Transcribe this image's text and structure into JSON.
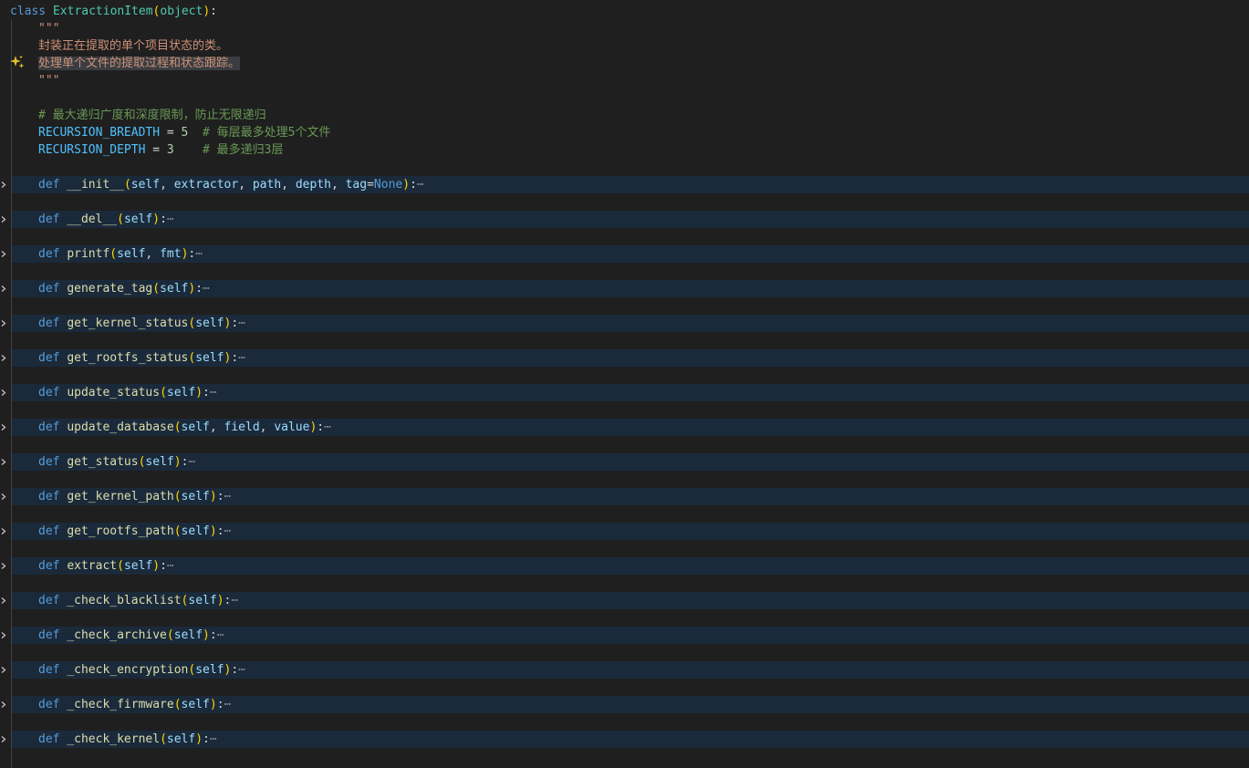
{
  "class_line": {
    "keyword": "class",
    "name": "ExtractionItem",
    "base": "object"
  },
  "docstring": {
    "open": "\"\"\"",
    "line1": "封装正在提取的单个项目状态的类。",
    "line2": "处理单个文件的提取过程和状态跟踪。",
    "close": "\"\"\""
  },
  "comment_main": "# 最大递归广度和深度限制，防止无限递归",
  "constants": [
    {
      "name": "RECURSION_BREADTH",
      "op": " = ",
      "value": "5",
      "pad": "  ",
      "comment": "# 每层最多处理5个文件"
    },
    {
      "name": "RECURSION_DEPTH",
      "op": " = ",
      "value": "3",
      "pad": "    ",
      "comment": "# 最多递归3层"
    }
  ],
  "methods": [
    {
      "name": "__init__",
      "params": [
        "self",
        "extractor",
        "path",
        "depth"
      ],
      "default_param": "tag",
      "default_value": "None"
    },
    {
      "name": "__del__",
      "params": [
        "self"
      ]
    },
    {
      "name": "printf",
      "params": [
        "self",
        "fmt"
      ]
    },
    {
      "name": "generate_tag",
      "params": [
        "self"
      ]
    },
    {
      "name": "get_kernel_status",
      "params": [
        "self"
      ]
    },
    {
      "name": "get_rootfs_status",
      "params": [
        "self"
      ]
    },
    {
      "name": "update_status",
      "params": [
        "self"
      ]
    },
    {
      "name": "update_database",
      "params": [
        "self",
        "field",
        "value"
      ]
    },
    {
      "name": "get_status",
      "params": [
        "self"
      ]
    },
    {
      "name": "get_kernel_path",
      "params": [
        "self"
      ]
    },
    {
      "name": "get_rootfs_path",
      "params": [
        "self"
      ]
    },
    {
      "name": "extract",
      "params": [
        "self"
      ]
    },
    {
      "name": "_check_blacklist",
      "params": [
        "self"
      ]
    },
    {
      "name": "_check_archive",
      "params": [
        "self"
      ]
    },
    {
      "name": "_check_encryption",
      "params": [
        "self"
      ]
    },
    {
      "name": "_check_firmware",
      "params": [
        "self"
      ]
    },
    {
      "name": "_check_kernel",
      "params": [
        "self"
      ]
    }
  ],
  "def_keyword": "def",
  "fold_ellipsis": "⋯",
  "icons": {
    "ai_sparkle": "sparkle-icon",
    "fold": "chevron-right-icon"
  },
  "colors": {
    "background": "#1f1f1f",
    "folded_line": "#1b2a3b",
    "keyword": "#569cd6",
    "class_name": "#4ec9b0",
    "function": "#dcdcaa",
    "parameter": "#9cdcfe",
    "string": "#ce9178",
    "comment": "#6a9955",
    "constant": "#4fc1ff",
    "bracket": "#ffd700"
  }
}
